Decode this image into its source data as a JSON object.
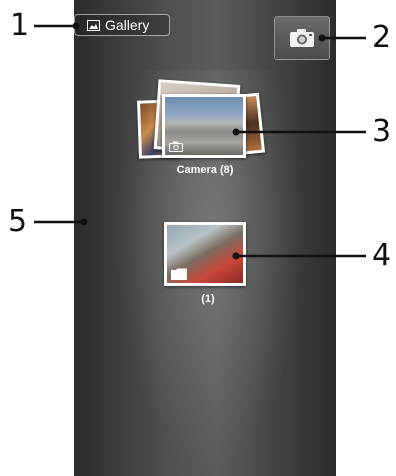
{
  "header": {
    "gallery_label": "Gallery",
    "camera_icon": "camera-icon"
  },
  "albums": [
    {
      "label": "Camera  (8)",
      "icon": "camera-icon"
    },
    {
      "label": "(1)",
      "icon": "folder-icon"
    }
  ],
  "callouts": [
    "1",
    "2",
    "3",
    "4",
    "5"
  ],
  "colors": {
    "background": "#4e504e",
    "text": "#ffffff",
    "callout": "#111111"
  }
}
